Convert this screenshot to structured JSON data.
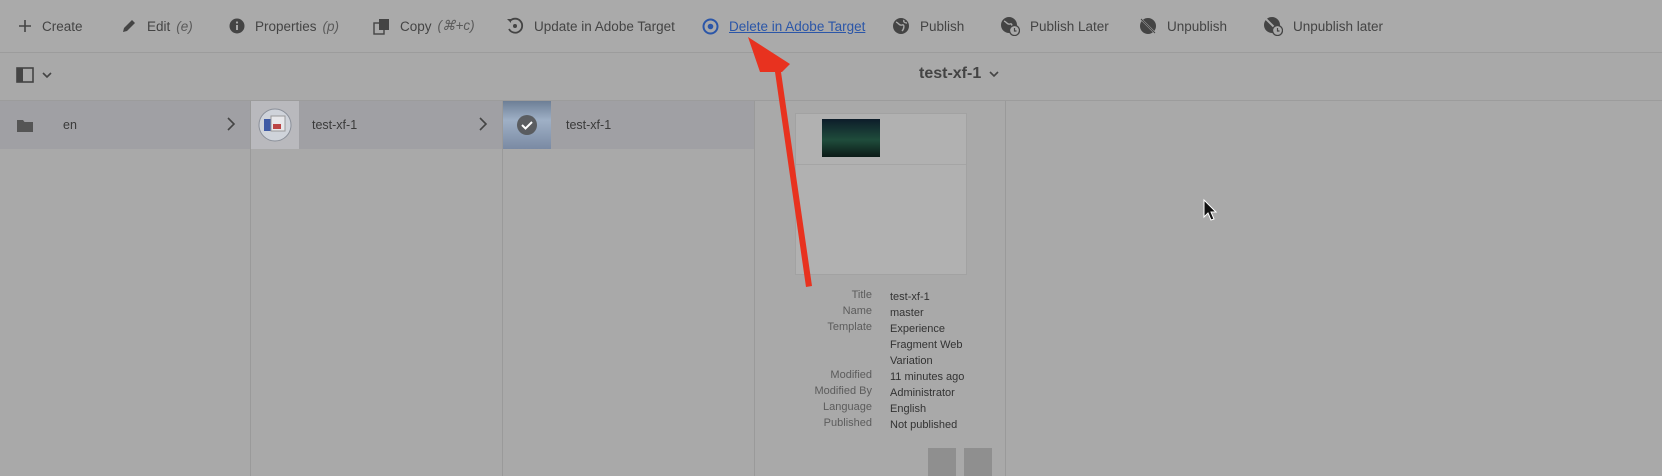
{
  "toolbar": {
    "create": "Create",
    "edit": "Edit",
    "edit_shortcut": "(e)",
    "properties": "Properties",
    "properties_shortcut": "(p)",
    "copy": "Copy",
    "copy_shortcut": "(⌘+c)",
    "update_target": "Update in Adobe Target",
    "delete_target": "Delete in Adobe Target",
    "publish": "Publish",
    "publish_later": "Publish Later",
    "unpublish": "Unpublish",
    "unpublish_later": "Unpublish later"
  },
  "header": {
    "title": "test-xf-1"
  },
  "columns": [
    {
      "label": "en",
      "icon": "folder-icon"
    },
    {
      "label": "test-xf-1",
      "icon": "experience-fragment-thumbnail"
    },
    {
      "label": "test-xf-1",
      "icon": "variation-thumbnail-selected"
    }
  ],
  "details": [
    {
      "key": "Title",
      "value": "test-xf-1"
    },
    {
      "key": "Name",
      "value": "master"
    },
    {
      "key": "Template",
      "value": "Experience Fragment Web Variation"
    },
    {
      "key": "Modified",
      "value": "11 minutes ago"
    },
    {
      "key": "Modified By",
      "value": "Administrator"
    },
    {
      "key": "Language",
      "value": "English"
    },
    {
      "key": "Published",
      "value": "Not published"
    }
  ],
  "colors": {
    "arrow": "#e8321f",
    "link": "#2b56a8"
  }
}
